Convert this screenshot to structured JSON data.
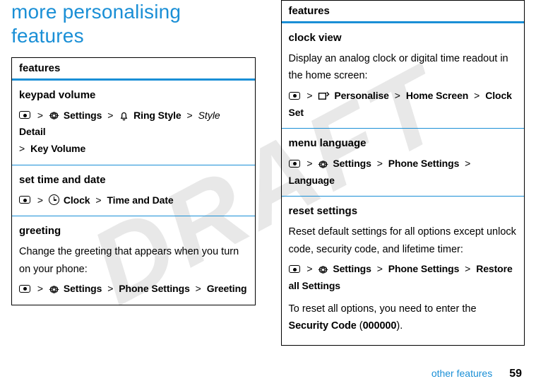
{
  "watermark": "DRAFT",
  "section_title": "more personalising features",
  "table_header": "features",
  "left": {
    "rows": [
      {
        "name": "keypad volume",
        "desc": "",
        "path_pre": "",
        "path_parts": [
          "Settings",
          "Ring Style",
          "Detail",
          "Key Volume"
        ],
        "style_word": "Style"
      },
      {
        "name": "set time and date",
        "desc": "",
        "path_parts": [
          "Clock",
          "Time and Date"
        ]
      },
      {
        "name": "greeting",
        "desc": "Change the greeting that appears when you turn on your phone:",
        "path_parts": [
          "Settings",
          "Phone Settings",
          "Greeting"
        ]
      }
    ]
  },
  "right": {
    "rows": [
      {
        "name": "clock view",
        "desc": "Display an analog clock or digital time readout in the home screen:",
        "path_parts": [
          "Personalise",
          "Home Screen",
          "Clock Set"
        ]
      },
      {
        "name": "menu language",
        "desc": "",
        "path_parts": [
          "Settings",
          "Phone Settings",
          "Language"
        ]
      },
      {
        "name": "reset settings",
        "desc": "Reset default settings for all options except unlock code, security code, and lifetime timer:",
        "path_parts": [
          "Settings",
          "Phone Settings",
          "Restore all Settings"
        ],
        "post": "To reset all options, you need to enter the ",
        "post_bold": "Security Code",
        "post2": " (",
        "post_bold2": "000000",
        "post3": ")."
      }
    ]
  },
  "footer": {
    "label": "other features",
    "page": "59"
  }
}
